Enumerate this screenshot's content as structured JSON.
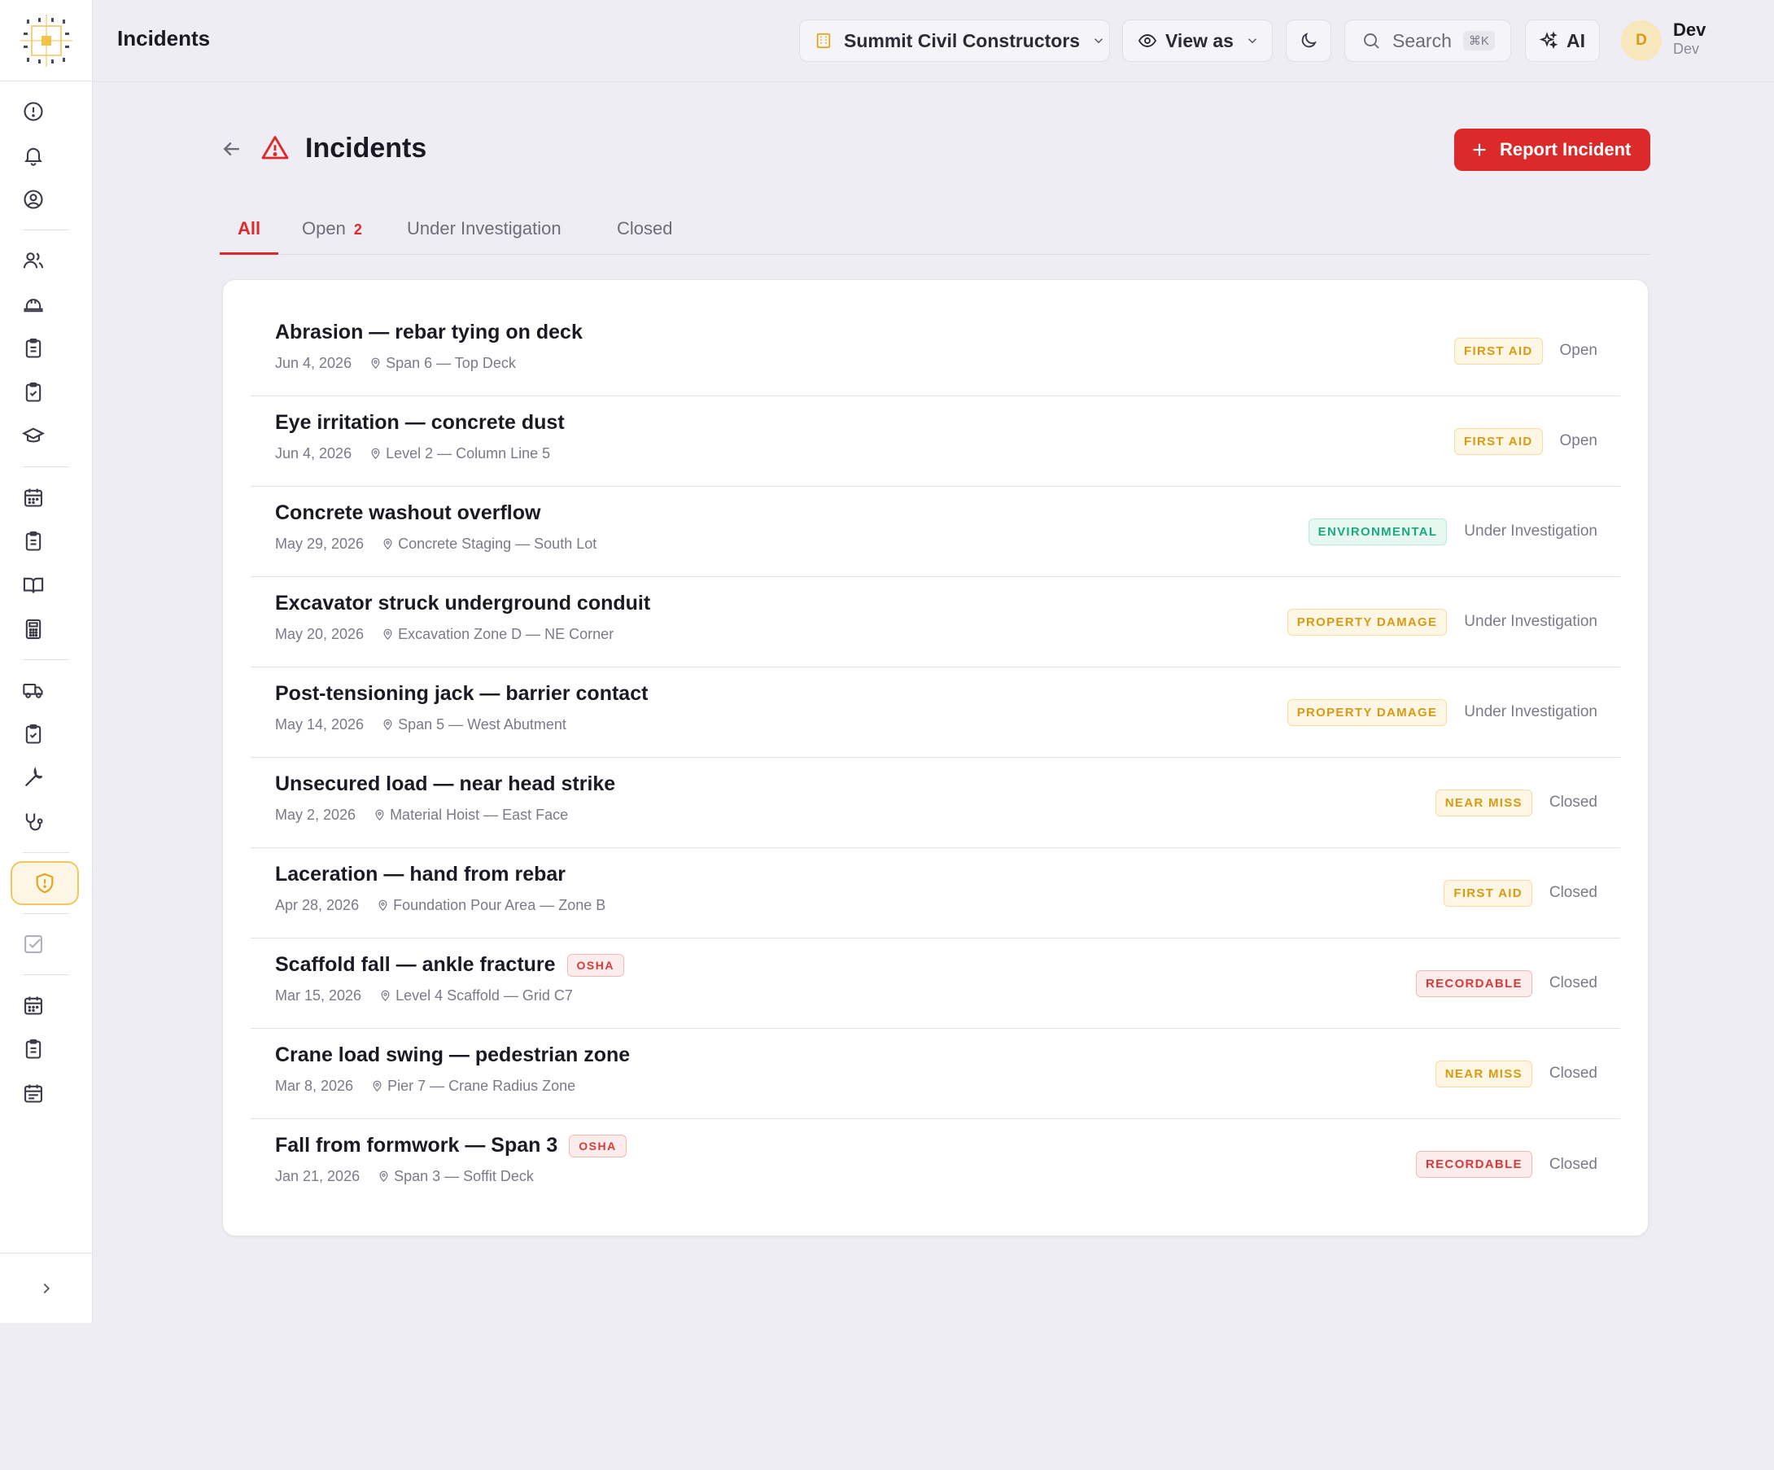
{
  "header": {
    "title": "Incidents",
    "org": "Summit Civil Constructors",
    "view_as": "View as",
    "search": "Search",
    "search_kbd": "⌘K",
    "ai": "AI",
    "avatar_initial": "D",
    "user_name": "Dev",
    "user_role": "Dev"
  },
  "page": {
    "title": "Incidents",
    "report_button": "Report Incident"
  },
  "tabs": [
    {
      "label": "All"
    },
    {
      "label": "Open",
      "count": "2"
    },
    {
      "label": "Under Investigation"
    },
    {
      "label": "Closed"
    }
  ],
  "incidents": [
    {
      "title": "Abrasion — rebar tying on deck",
      "date": "Jun 4, 2026",
      "location": "Span 6 — Top Deck",
      "type": "FIRST AID",
      "status": "Open"
    },
    {
      "title": "Eye irritation — concrete dust",
      "date": "Jun 4, 2026",
      "location": "Level 2 — Column Line 5",
      "type": "FIRST AID",
      "status": "Open"
    },
    {
      "title": "Concrete washout overflow",
      "date": "May 29, 2026",
      "location": "Concrete Staging — South Lot",
      "type": "ENVIRONMENTAL",
      "status": "Under Investigation"
    },
    {
      "title": "Excavator struck underground conduit",
      "date": "May 20, 2026",
      "location": "Excavation Zone D — NE Corner",
      "type": "PROPERTY DAMAGE",
      "status": "Under Investigation"
    },
    {
      "title": "Post-tensioning jack — barrier contact",
      "date": "May 14, 2026",
      "location": "Span 5 — West Abutment",
      "type": "PROPERTY DAMAGE",
      "status": "Under Investigation"
    },
    {
      "title": "Unsecured load — near head strike",
      "date": "May 2, 2026",
      "location": "Material Hoist — East Face",
      "type": "NEAR MISS",
      "status": "Closed"
    },
    {
      "title": "Laceration — hand from rebar",
      "date": "Apr 28, 2026",
      "location": "Foundation Pour Area — Zone B",
      "type": "FIRST AID",
      "status": "Closed"
    },
    {
      "title": "Scaffold fall — ankle fracture",
      "date": "Mar 15, 2026",
      "location": "Level 4 Scaffold — Grid C7",
      "type": "RECORDABLE",
      "status": "Closed",
      "osha": "OSHA"
    },
    {
      "title": "Crane load swing — pedestrian zone",
      "date": "Mar 8, 2026",
      "location": "Pier 7 — Crane Radius Zone",
      "type": "NEAR MISS",
      "status": "Closed"
    },
    {
      "title": "Fall from formwork — Span 3",
      "date": "Jan 21, 2026",
      "location": "Span 3 — Soffit Deck",
      "type": "RECORDABLE",
      "status": "Closed",
      "osha": "OSHA"
    }
  ],
  "colors": {
    "accent_red": "#dc2a2a",
    "amber": "#d89a12",
    "green": "#1aa97f",
    "sidebar_active": "#e0a416"
  }
}
